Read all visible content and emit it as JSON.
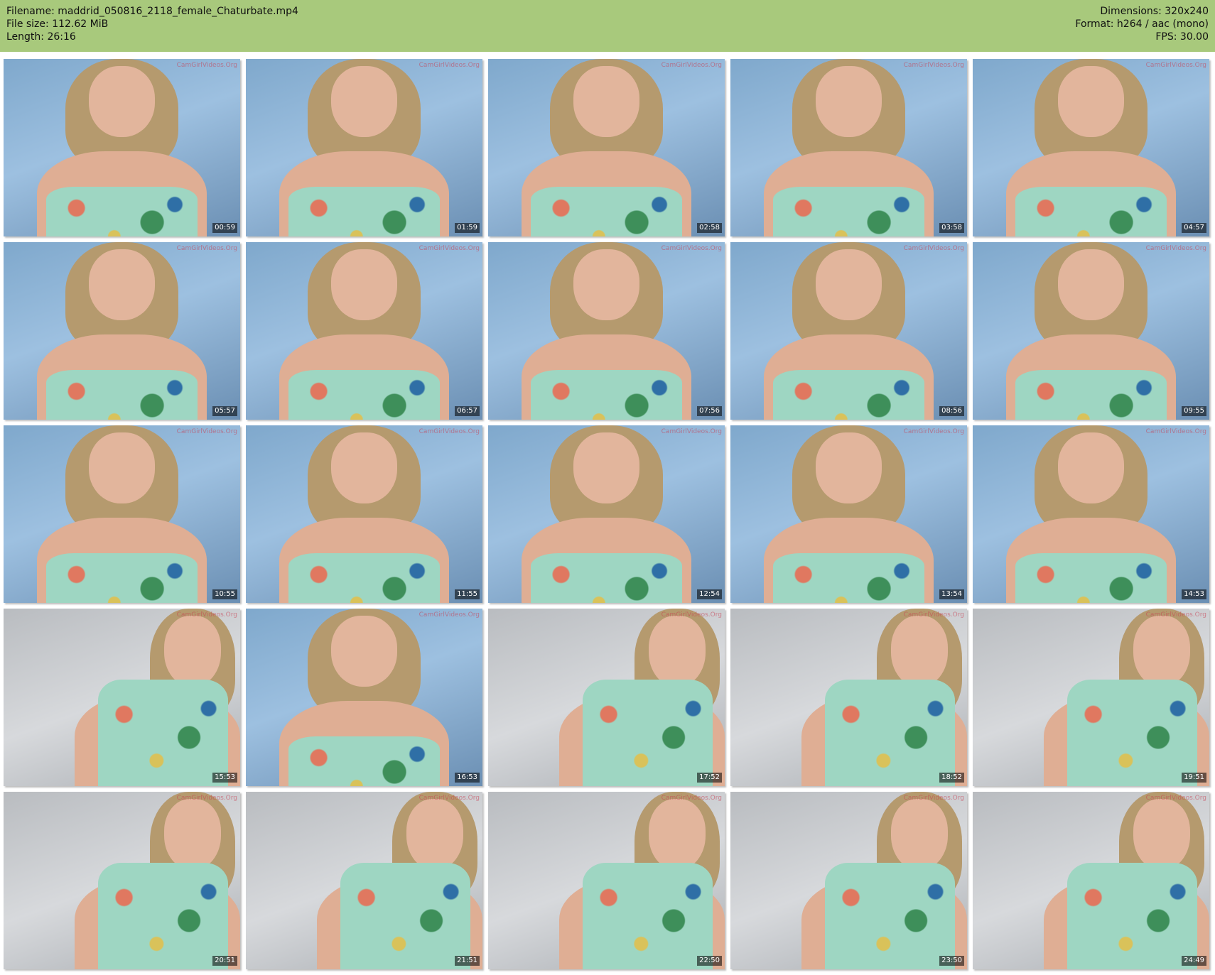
{
  "header": {
    "filename": "Filename: maddrid_050816_2118_female_Chaturbate.mp4",
    "filesize": "File size: 112.62 MiB",
    "length": "Length: 26:16",
    "dimensions": "Dimensions: 320x240",
    "format": "Format: h264 / aac (mono)",
    "fps": "FPS: 30.00"
  },
  "thumbnails": [
    {
      "time": "00:59",
      "watermark": "CamGirlVideos.Org",
      "scene": "blue"
    },
    {
      "time": "01:59",
      "watermark": "CamGirlVideos.Org",
      "scene": "blue"
    },
    {
      "time": "02:58",
      "watermark": "CamGirlVideos.Org",
      "scene": "blue"
    },
    {
      "time": "03:58",
      "watermark": "CamGirlVideos.Org",
      "scene": "blue"
    },
    {
      "time": "04:57",
      "watermark": "CamGirlVideos.Org",
      "scene": "blue"
    },
    {
      "time": "05:57",
      "watermark": "CamGirlVideos.Org",
      "scene": "blue"
    },
    {
      "time": "06:57",
      "watermark": "CamGirlVideos.Org",
      "scene": "blue"
    },
    {
      "time": "07:56",
      "watermark": "CamGirlVideos.Org",
      "scene": "blue"
    },
    {
      "time": "08:56",
      "watermark": "CamGirlVideos.Org",
      "scene": "blue"
    },
    {
      "time": "09:55",
      "watermark": "CamGirlVideos.Org",
      "scene": "blue"
    },
    {
      "time": "10:55",
      "watermark": "CamGirlVideos.Org",
      "scene": "blue"
    },
    {
      "time": "11:55",
      "watermark": "CamGirlVideos.Org",
      "scene": "blue"
    },
    {
      "time": "12:54",
      "watermark": "CamGirlVideos.Org",
      "scene": "blue"
    },
    {
      "time": "13:54",
      "watermark": "CamGirlVideos.Org",
      "scene": "blue"
    },
    {
      "time": "14:53",
      "watermark": "CamGirlVideos.Org",
      "scene": "blue"
    },
    {
      "time": "15:53",
      "watermark": "CamGirlVideos.Org",
      "scene": "gray"
    },
    {
      "time": "16:53",
      "watermark": "CamGirlVideos.Org",
      "scene": "blue"
    },
    {
      "time": "17:52",
      "watermark": "CamGirlVideos.Org",
      "scene": "gray"
    },
    {
      "time": "18:52",
      "watermark": "CamGirlVideos.Org",
      "scene": "gray"
    },
    {
      "time": "19:51",
      "watermark": "CamGirlVideos.Org",
      "scene": "gray"
    },
    {
      "time": "20:51",
      "watermark": "CamGirlVideos.Org",
      "scene": "gray"
    },
    {
      "time": "21:51",
      "watermark": "CamGirlVideos.Org",
      "scene": "gray"
    },
    {
      "time": "22:50",
      "watermark": "CamGirlVideos.Org",
      "scene": "gray"
    },
    {
      "time": "23:50",
      "watermark": "CamGirlVideos.Org",
      "scene": "gray"
    },
    {
      "time": "24:49",
      "watermark": "CamGirlVideos.Org",
      "scene": "gray"
    }
  ],
  "colors": {
    "header_bg": "#a8c97c",
    "timestamp_bg": "#000000",
    "watermark": "#c83c50"
  }
}
